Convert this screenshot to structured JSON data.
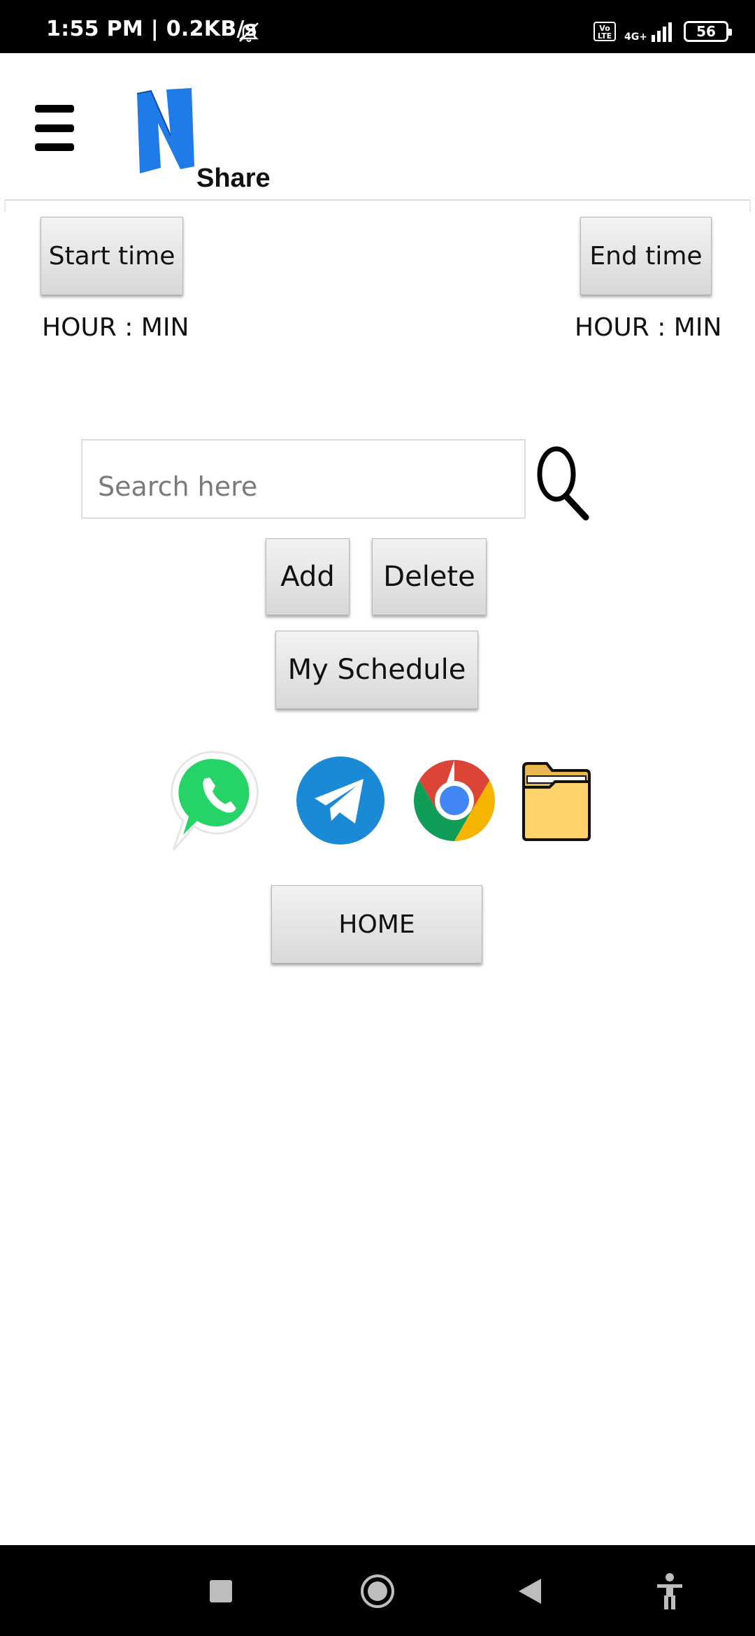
{
  "status_bar": {
    "time": "1:55 PM | 0.2KB/s",
    "volte": "Vo LTE",
    "network": "4G+",
    "battery": "56"
  },
  "header": {
    "logo_letter": "N",
    "logo_word": "Share"
  },
  "schedule": {
    "start_button": "Start time",
    "end_button": "End time",
    "start_value": "HOUR : MIN",
    "end_value": "HOUR : MIN"
  },
  "search": {
    "placeholder": "Search here",
    "value": ""
  },
  "actions": {
    "add": "Add",
    "delete": "Delete",
    "my_schedule": "My Schedule",
    "home": "HOME"
  },
  "apps": [
    {
      "name": "WhatsApp",
      "icon": "whatsapp-icon",
      "color": "#25D366"
    },
    {
      "name": "Telegram",
      "icon": "telegram-icon",
      "color": "#1A8AD6"
    },
    {
      "name": "Chrome",
      "icon": "chrome-icon",
      "color": "#DB4437"
    },
    {
      "name": "Files",
      "icon": "folder-icon",
      "color": "#FFD36B"
    }
  ],
  "colors": {
    "brand_blue": "#1E7BE8",
    "status_bar": "#000000",
    "button_gradient_top": "#f3f3f3",
    "button_gradient_bottom": "#d8d8d8"
  }
}
